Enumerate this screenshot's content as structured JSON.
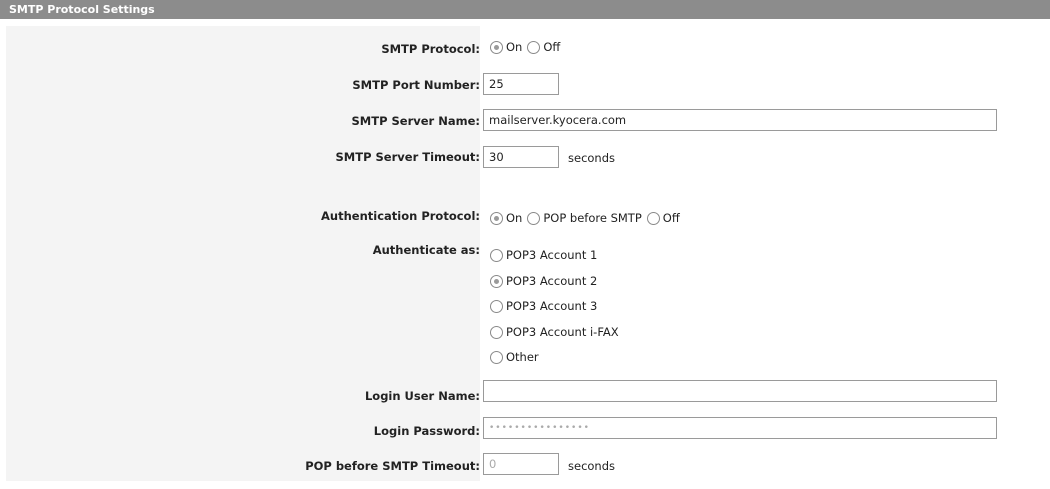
{
  "header": {
    "title": "SMTP Protocol Settings"
  },
  "smtp_protocol": {
    "label": "SMTP Protocol:",
    "options": [
      "On",
      "Off"
    ],
    "selected": "On"
  },
  "smtp_port": {
    "label": "SMTP Port Number:",
    "value": "25"
  },
  "smtp_server_name": {
    "label": "SMTP Server Name:",
    "value": "mailserver.kyocera.com"
  },
  "smtp_timeout": {
    "label": "SMTP Server Timeout:",
    "value": "30",
    "unit": "seconds"
  },
  "auth_protocol": {
    "label": "Authentication Protocol:",
    "options": [
      "On",
      "POP before SMTP",
      "Off"
    ],
    "selected": "On"
  },
  "authenticate_as": {
    "label": "Authenticate as:",
    "options": [
      "POP3 Account 1",
      "POP3 Account 2",
      "POP3 Account 3",
      "POP3 Account i-FAX",
      "Other"
    ],
    "selected": "POP3 Account 2"
  },
  "login_user": {
    "label": "Login User Name:",
    "value": ""
  },
  "login_password": {
    "label": "Login Password:",
    "value": "••••••••••••••••"
  },
  "pop_timeout": {
    "label": "POP before SMTP Timeout:",
    "value": "0",
    "unit": "seconds"
  }
}
